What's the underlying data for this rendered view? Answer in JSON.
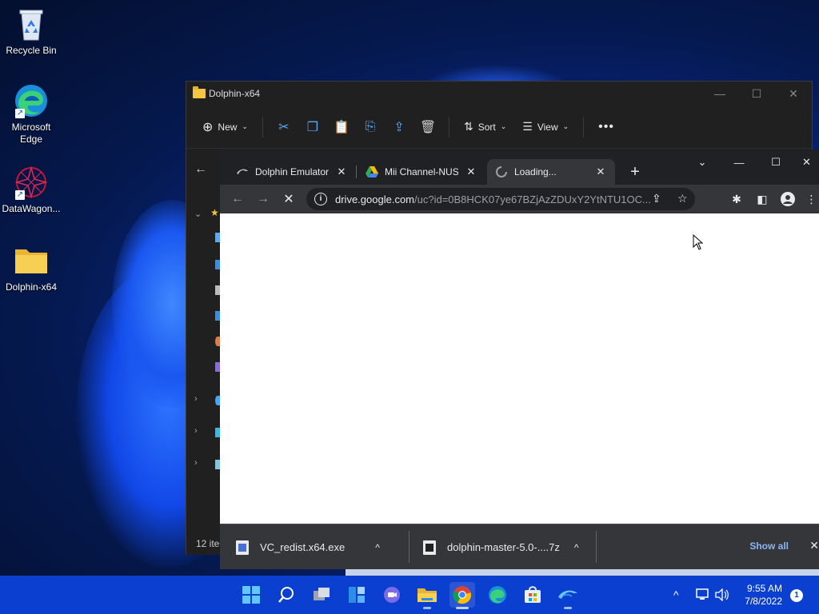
{
  "desktop": {
    "icons": [
      {
        "label": "Recycle Bin",
        "icon": "recycle-bin-icon"
      },
      {
        "label": "Microsoft Edge",
        "icon": "edge-icon"
      },
      {
        "label": "DataWagon...",
        "icon": "datawagon-icon"
      },
      {
        "label": "Dolphin-x64",
        "icon": "folder-icon"
      }
    ]
  },
  "explorer": {
    "title": "Dolphin-x64",
    "toolbar": {
      "new_label": "New",
      "sort_label": "Sort",
      "view_label": "View"
    },
    "status": "12 ite"
  },
  "chrome": {
    "tabs": [
      {
        "label": "Dolphin Emulator",
        "icon": "dolphin-tab-icon"
      },
      {
        "label": "Mii Channel-NUS-",
        "icon": "google-drive-icon"
      },
      {
        "label": "Loading...",
        "icon": "loading-spinner-icon"
      }
    ],
    "url_host": "drive.google.com",
    "url_path": "/uc?id=0B8HCK07ye67BZjAzZDUxY2YtNTU1OC...",
    "downloads": [
      {
        "name": "VC_redist.x64.exe"
      },
      {
        "name": "dolphin-master-5.0-....7z"
      }
    ],
    "show_all": "Show all"
  },
  "taskbar": {
    "apps": [
      "windows-start-icon",
      "search-icon",
      "task-view-icon",
      "widgets-icon",
      "chat-icon",
      "file-explorer-icon",
      "chrome-icon",
      "edge-icon",
      "store-icon",
      "dolphin-icon"
    ],
    "time": "9:55 AM",
    "date": "7/8/2022",
    "notifications": "1"
  },
  "colors": {
    "accent": "#0b3fd0",
    "chrome_dark": "#202124",
    "explorer_bg": "#202020"
  }
}
